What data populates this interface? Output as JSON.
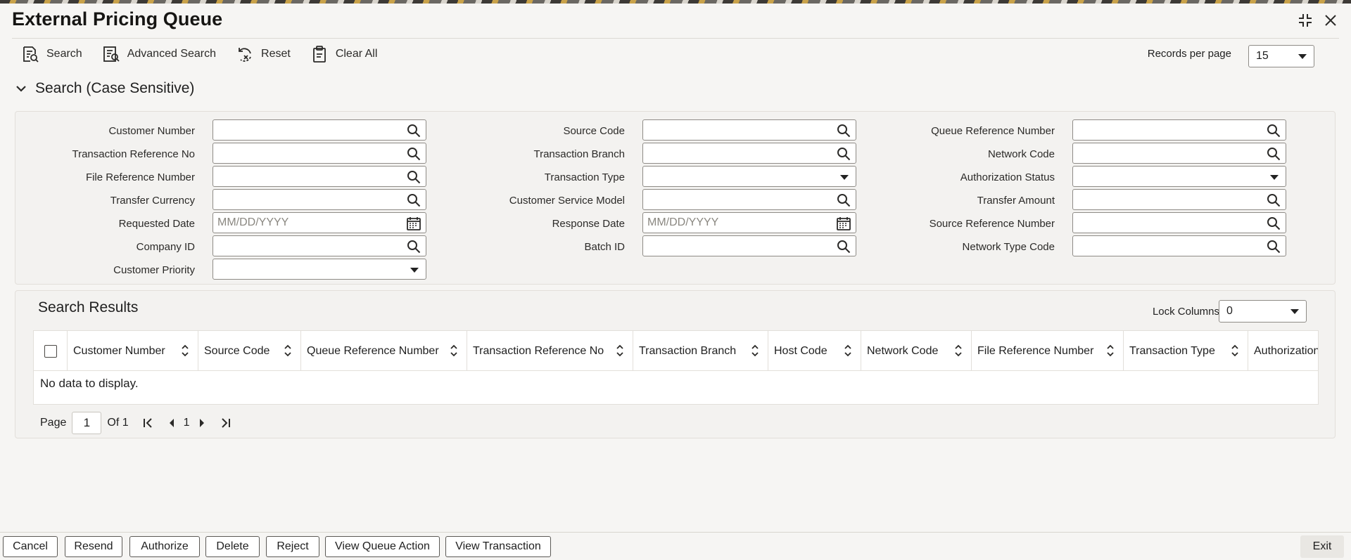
{
  "window": {
    "title": "External Pricing Queue"
  },
  "toolbar": {
    "search_label": "Search",
    "advanced_search_label": "Advanced Search",
    "reset_label": "Reset",
    "clear_all_label": "Clear All",
    "records_per_page_label": "Records per page",
    "records_per_page_value": "15"
  },
  "search_section": {
    "title": "Search (Case Sensitive)",
    "fields": {
      "customer_number": {
        "label": "Customer Number",
        "value": ""
      },
      "transaction_reference_no": {
        "label": "Transaction Reference No",
        "value": ""
      },
      "file_reference_number": {
        "label": "File Reference Number",
        "value": ""
      },
      "transfer_currency": {
        "label": "Transfer Currency",
        "value": ""
      },
      "requested_date": {
        "label": "Requested Date",
        "placeholder": "MM/DD/YYYY"
      },
      "company_id": {
        "label": "Company ID",
        "value": ""
      },
      "customer_priority": {
        "label": "Customer Priority",
        "value": ""
      },
      "source_code": {
        "label": "Source Code",
        "value": ""
      },
      "transaction_branch": {
        "label": "Transaction Branch",
        "value": ""
      },
      "transaction_type": {
        "label": "Transaction Type",
        "value": ""
      },
      "customer_service_model": {
        "label": "Customer Service Model",
        "value": ""
      },
      "response_date": {
        "label": "Response Date",
        "placeholder": "MM/DD/YYYY"
      },
      "batch_id": {
        "label": "Batch ID",
        "value": ""
      },
      "queue_reference_number": {
        "label": "Queue Reference Number",
        "value": ""
      },
      "network_code": {
        "label": "Network Code",
        "value": ""
      },
      "authorization_status": {
        "label": "Authorization Status",
        "value": ""
      },
      "transfer_amount": {
        "label": "Transfer Amount",
        "value": ""
      },
      "source_reference_number": {
        "label": "Source Reference Number",
        "value": ""
      },
      "network_type_code": {
        "label": "Network Type Code",
        "value": ""
      }
    }
  },
  "results": {
    "title": "Search Results",
    "lock_columns_label": "Lock Columns",
    "lock_columns_value": "0",
    "columns": [
      "Customer Number",
      "Source Code",
      "Queue Reference Number",
      "Transaction Reference No",
      "Transaction Branch",
      "Host Code",
      "Network Code",
      "File Reference Number",
      "Transaction Type",
      "Authorization"
    ],
    "rows": [],
    "empty_text": "No data to display."
  },
  "pagination": {
    "page_label": "Page",
    "current_page": "1",
    "of_label": "Of 1",
    "nav_page": "1"
  },
  "footer": {
    "buttons": [
      "Cancel",
      "Resend",
      "Authorize",
      "Delete",
      "Reject",
      "View Queue Action",
      "View Transaction"
    ],
    "exit_label": "Exit"
  }
}
